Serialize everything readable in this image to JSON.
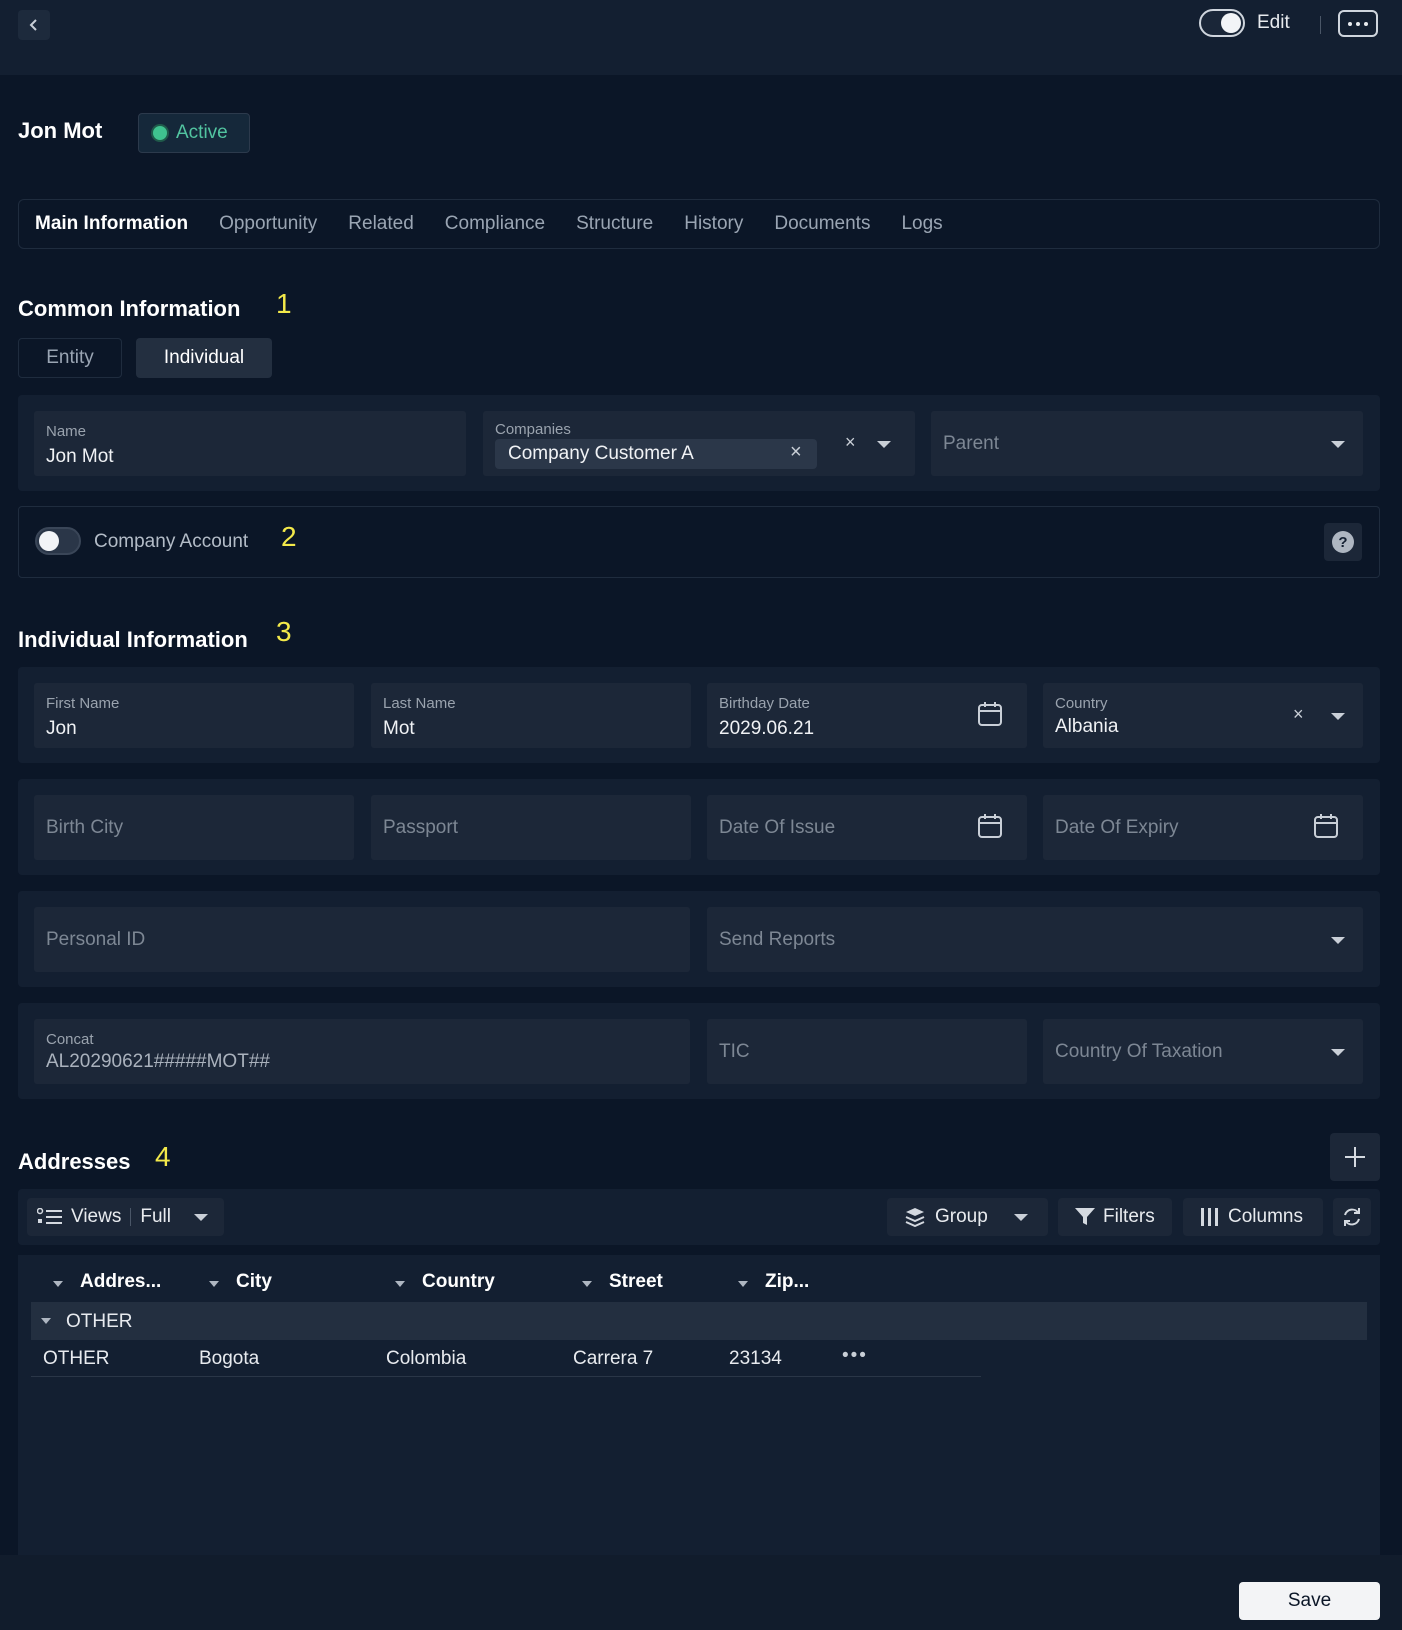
{
  "header": {
    "edit_label": "Edit"
  },
  "record": {
    "name": "Jon Mot",
    "status": "Active"
  },
  "tabs": [
    {
      "label": "Main Information"
    },
    {
      "label": "Opportunity"
    },
    {
      "label": "Related"
    },
    {
      "label": "Compliance"
    },
    {
      "label": "Structure"
    },
    {
      "label": "History"
    },
    {
      "label": "Documents"
    },
    {
      "label": "Logs"
    }
  ],
  "common": {
    "title": "Common Information",
    "number": "1",
    "segments": [
      {
        "label": "Entity"
      },
      {
        "label": "Individual"
      }
    ],
    "name_label": "Name",
    "name_value": "Jon Mot",
    "companies_label": "Companies",
    "companies_chip": "Company Customer A",
    "parent_placeholder": "Parent"
  },
  "account": {
    "label": "Company Account",
    "number": "2",
    "help": "?"
  },
  "individual": {
    "title": "Individual Information",
    "number": "3",
    "first_name_label": "First Name",
    "first_name_value": "Jon",
    "last_name_label": "Last Name",
    "last_name_value": "Mot",
    "birthday_label": "Birthday Date",
    "birthday_value": "2029.06.21",
    "country_label": "Country",
    "country_value": "Albania",
    "birth_city_placeholder": "Birth City",
    "passport_placeholder": "Passport",
    "date_issue_placeholder": "Date Of Issue",
    "date_expiry_placeholder": "Date Of Expiry",
    "personal_id_placeholder": "Personal ID",
    "send_reports_placeholder": "Send Reports",
    "concat_label": "Concat",
    "concat_value": "AL20290621#####MOT##",
    "tic_placeholder": "TIC",
    "country_tax_placeholder": "Country Of Taxation"
  },
  "addresses": {
    "title": "Addresses",
    "number": "4",
    "views_label": "Views",
    "views_value": "Full",
    "group_label": "Group",
    "filters_label": "Filters",
    "columns_label": "Columns",
    "columns": [
      "Addres...",
      "City",
      "Country",
      "Street",
      "Zip..."
    ],
    "group_name": "OTHER",
    "rows": [
      {
        "address": "OTHER",
        "city": "Bogota",
        "country": "Colombia",
        "street": "Carrera 7",
        "zip": "23134",
        "more": "•••"
      }
    ]
  },
  "footer": {
    "save_label": "Save"
  }
}
